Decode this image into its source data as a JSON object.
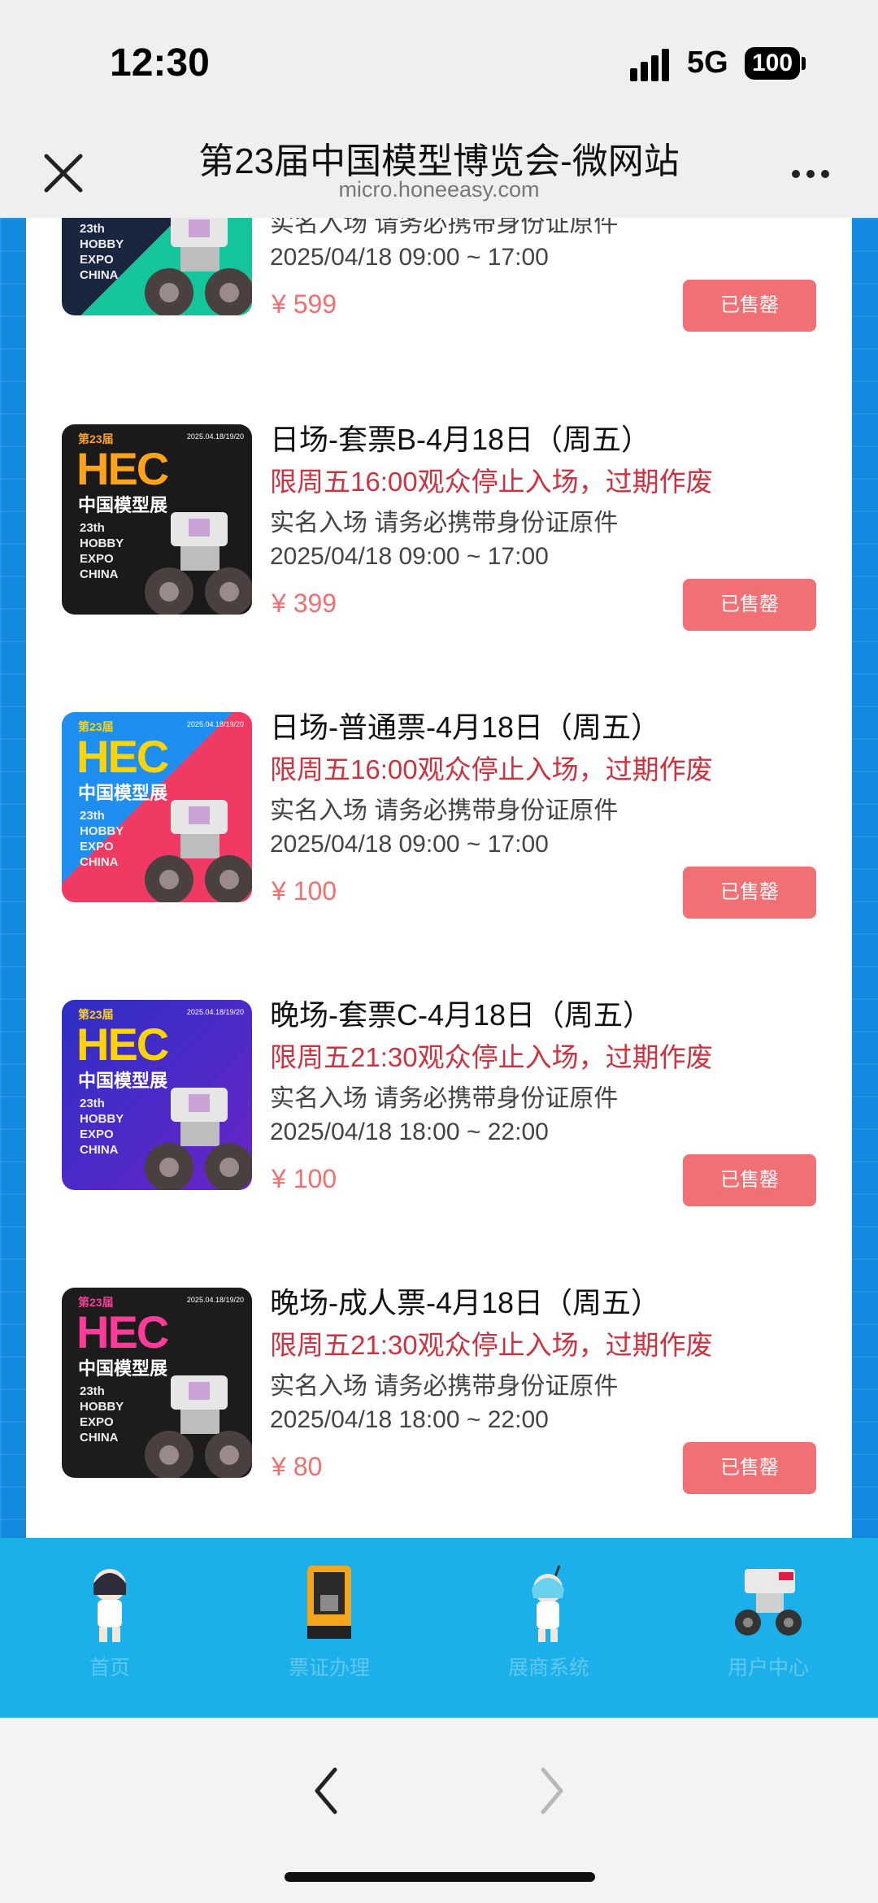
{
  "status": {
    "time": "12:30",
    "network": "5G",
    "battery": "100"
  },
  "header": {
    "title": "第23届中国模型博览会-微网站",
    "url": "micro.honeeasy.com"
  },
  "thumb_text": {
    "badge": "第23届",
    "brand": "HEC",
    "cn": "中国模型展",
    "hobby": "23th\nHOBBY\nEXPO\nCHINA",
    "date": "2025.04.18/19/20"
  },
  "tickets": [
    {
      "name": "",
      "warn": "",
      "note": "实名入场 请务必携带身份证原件",
      "time": "2025/04/18 09:00 ~ 17:00",
      "price": "¥ 599",
      "button": "已售罄",
      "color": "#1a2540"
    },
    {
      "name": "日场-套票B-4月18日（周五）",
      "warn": "限周五16:00观众停止入场，过期作废",
      "note": "实名入场 请务必携带身份证原件",
      "time": "2025/04/18 09:00 ~ 17:00",
      "price": "¥ 399",
      "button": "已售罄",
      "color": "#1a1a1a"
    },
    {
      "name": "日场-普通票-4月18日（周五）",
      "warn": "限周五16:00观众停止入场，过期作废",
      "note": "实名入场 请务必携带身份证原件",
      "time": "2025/04/18 09:00 ~ 17:00",
      "price": "¥ 100",
      "button": "已售罄",
      "color": "#1e7de6"
    },
    {
      "name": "晚场-套票C-4月18日（周五）",
      "warn": "限周五21:30观众停止入场，过期作废",
      "note": "实名入场 请务必携带身份证原件",
      "time": "2025/04/18 18:00 ~ 22:00",
      "price": "¥ 100",
      "button": "已售罄",
      "color": "#2d2fc6"
    },
    {
      "name": "晚场-成人票-4月18日（周五）",
      "warn": "限周五21:30观众停止入场，过期作废",
      "note": "实名入场 请务必携带身份证原件",
      "time": "2025/04/18 18:00 ~ 22:00",
      "price": "¥ 80",
      "button": "已售罄",
      "color": "#1c1c1c"
    }
  ],
  "nav": [
    {
      "label": "首页"
    },
    {
      "label": "票证办理"
    },
    {
      "label": "展商系统"
    },
    {
      "label": "用户中心"
    }
  ]
}
